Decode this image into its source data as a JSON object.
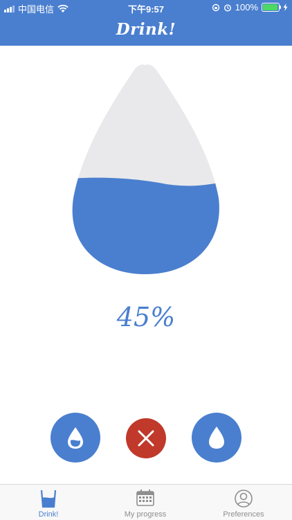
{
  "status_bar": {
    "carrier": "中国电信",
    "time": "下午9:57",
    "battery": "100%"
  },
  "header": {
    "title": "Drink!"
  },
  "hydration": {
    "fill_fraction": 0.45,
    "percent_label": "45%"
  },
  "actions": [
    {
      "name": "small-drink",
      "icon": "small-drop-icon"
    },
    {
      "name": "cancel",
      "icon": "close-icon"
    },
    {
      "name": "big-drink",
      "icon": "drop-icon"
    }
  ],
  "tabs": [
    {
      "label": "Drink!",
      "icon": "glass-icon",
      "active": true
    },
    {
      "label": "My progress",
      "icon": "calendar-icon",
      "active": false
    },
    {
      "label": "Preferences",
      "icon": "profile-icon",
      "active": false
    }
  ],
  "colors": {
    "primary": "#4a7fcf",
    "danger": "#c0392b",
    "drop_empty": "#e9e9eb",
    "battery": "#4cd964"
  }
}
